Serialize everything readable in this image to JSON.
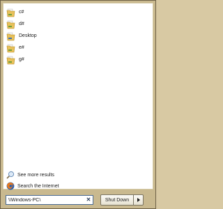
{
  "results": [
    {
      "label": "c#",
      "icon": "folder-icon"
    },
    {
      "label": "d#",
      "icon": "folder-icon"
    },
    {
      "label": "Desktop",
      "icon": "folder-icon"
    },
    {
      "label": "e#",
      "icon": "folder-icon"
    },
    {
      "label": "g#",
      "icon": "folder-icon"
    }
  ],
  "actions": {
    "see_more": {
      "label": "See more results",
      "icon": "magnifier-icon"
    },
    "search_internet": {
      "label": "Search the Internet",
      "icon": "firefox-icon"
    }
  },
  "search": {
    "value": "\\\\Windows-PC\\",
    "clear_icon": "close-icon"
  },
  "shutdown": {
    "label": "Shut Down",
    "arrow_icon": "chevron-right-icon"
  },
  "colors": {
    "frame": "#c9b98f",
    "pane": "#ffffff",
    "folder": "#e8c15a",
    "search_border": "#4a6a93"
  }
}
